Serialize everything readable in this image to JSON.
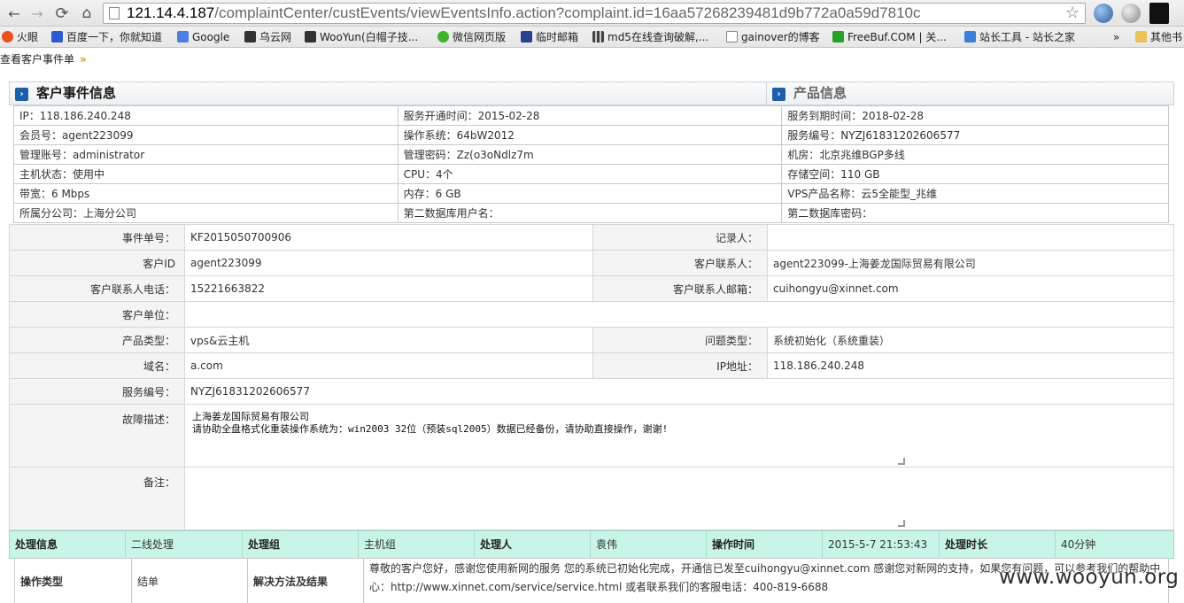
{
  "browser": {
    "url_host": "121.14.4.187",
    "url_path": "/complaintCenter/custEvents/viewEventsInfo.action?complaint.id=16aa57268239481d9b772a0a59d7810c",
    "bookmarks": [
      "火眼",
      "百度一下，你就知道",
      "Google",
      "乌云网",
      "WooYun(白帽子技...",
      "微信网页版",
      "临时邮箱",
      "md5在线查询破解,...",
      "gainover的博客",
      "FreeBuf.COM | 关...",
      "站长工具 - 站长之家",
      "»",
      "其他书"
    ]
  },
  "breadcrumb": "查看客户事件单",
  "panels": {
    "customer_title": "客户事件信息",
    "product_title": "产品信息"
  },
  "specs": [
    [
      "IP：118.186.240.248",
      "服务开通时间：2015-02-28",
      "服务到期时间：2018-02-28"
    ],
    [
      "会员号：agent223099",
      "操作系统：64bW2012",
      "服务编号：NYZJ61831202606577"
    ],
    [
      "管理账号：administrator",
      "管理密码：Zz(o3oNdlz7m",
      "机房：北京兆维BGP多线"
    ],
    [
      "主机状态：使用中",
      "CPU：4个",
      "存储空间：110 GB"
    ],
    [
      "带宽：6 Mbps",
      "内存：6 GB",
      "VPS产品名称：云5全能型_兆维"
    ],
    [
      "所属分公司：上海分公司",
      "第二数据库用户名：",
      "第二数据库密码："
    ]
  ],
  "detail": {
    "event_no_label": "事件单号：",
    "event_no": "KF2015050700906",
    "recorder_label": "记录人：",
    "recorder": "",
    "customer_id_label": "客户ID",
    "customer_id": "agent223099",
    "contact_label": "客户联系人：",
    "contact": "agent223099-上海姜龙国际贸易有限公司",
    "phone_label": "客户联系人电话：",
    "phone": "15221663822",
    "email_label": "客户联系人邮箱：",
    "email": "cuihongyu@xinnet.com",
    "unit_label": "客户单位：",
    "unit": "",
    "product_type_label": "产品类型：",
    "product_type": "vps&云主机",
    "issue_type_label": "问题类型：",
    "issue_type": "系统初始化（系统重装）",
    "domain_label": "域名：",
    "domain": "a.com",
    "ip_label": "IP地址：",
    "ip": "118.186.240.248",
    "service_no_label": "服务编号：",
    "service_no": "NYZJ61831202606577",
    "fault_label": "故障描述：",
    "fault_line1": "上海姜龙国际贸易有限公司",
    "fault_line2": "请协助全盘格式化重装操作系统为：win2003 32位（预装sql2005）数据已经备份，请协助直接操作，谢谢!",
    "remark_label": "备注："
  },
  "process": {
    "info_label": "处理信息",
    "info": "二线处理",
    "group_label": "处理组",
    "group": "主机组",
    "handler_label": "处理人",
    "handler": "袁伟",
    "time_label": "操作时间",
    "time": "2015-5-7 21:53:43",
    "duration_label": "处理时长",
    "duration": "40分钟",
    "op_type_label": "操作类型",
    "op_type": "结单",
    "solution_label": "解决方法及结果",
    "solution": "尊敬的客户您好，感谢您使用新网的服务 您的系统已初始化完成，开通信已发至cuihongyu@xinnet.com 感谢您对新网的支持，如果您有问题，可以参考我们的帮助中心：http://www.xinnet.com/service/service.html 或者联系我们的客服电话：400-819-6688"
  },
  "watermark": "www.wooyun.org"
}
